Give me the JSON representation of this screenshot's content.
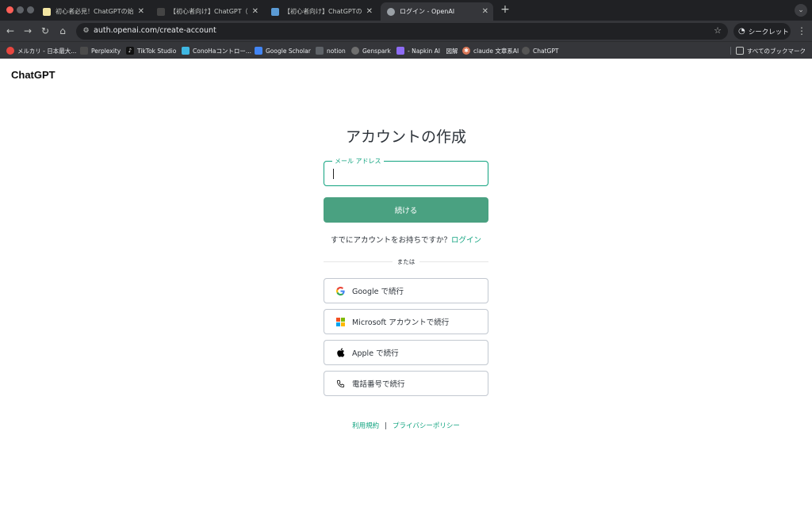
{
  "browser": {
    "tabs": [
      {
        "label": "初心者必見！ChatGPTの始め方",
        "favicon_color": "#f3e6a3",
        "active": false
      },
      {
        "label": "【初心者向け】ChatGPT（Ope",
        "favicon_color": "#444444",
        "active": false
      },
      {
        "label": "【初心者向け】ChatGPTのおす",
        "favicon_color": "#5b9bd5",
        "active": false
      },
      {
        "label": "ログイン - OpenAI",
        "favicon_color": "#9aa0a6",
        "active": true
      }
    ],
    "new_tab": "+",
    "url": "auth.openai.com/create-account",
    "incognito_label": "シークレット",
    "bookmarks": [
      {
        "label": "メルカリ - 日本最大...",
        "color": "#e8463f"
      },
      {
        "label": "Perplexity",
        "color": "#4b4b4b"
      },
      {
        "label": "TikTok Studio",
        "color": "#111111"
      },
      {
        "label": "ConoHaコントロー...",
        "color": "#3fb7e2"
      },
      {
        "label": "Google Scholar",
        "color": "#4285f4"
      },
      {
        "label": "notion",
        "color": "#5f6368"
      },
      {
        "label": "Genspark",
        "color": "#6f6f6f"
      },
      {
        "label": "- Napkin AI　図解",
        "color": "#8e6cf5"
      },
      {
        "label": "claude 文章系AI",
        "color": "#d97757"
      },
      {
        "label": "ChatGPT",
        "color": "#555555"
      }
    ],
    "all_bookmarks": "すべてのブックマーク"
  },
  "page": {
    "brand": "ChatGPT",
    "title": "アカウントの作成",
    "email_label": "メール アドレス",
    "email_value": "",
    "continue_label": "続ける",
    "already_text": "すでにアカウントをお持ちですか？",
    "login_link": "ログイン",
    "or_text": "または",
    "social": [
      {
        "label": "Google で続行",
        "icon": "google-icon"
      },
      {
        "label": "Microsoft アカウントで続行",
        "icon": "microsoft-icon"
      },
      {
        "label": "Apple で続行",
        "icon": "apple-icon"
      },
      {
        "label": "電話番号で続行",
        "icon": "phone-icon"
      }
    ],
    "footer": {
      "terms": "利用規約",
      "separator": "|",
      "privacy": "プライバシーポリシー"
    }
  },
  "colors": {
    "accent": "#10a37f",
    "button": "#4aa181",
    "chrome_dark": "#202124",
    "chrome_mid": "#35363a"
  }
}
